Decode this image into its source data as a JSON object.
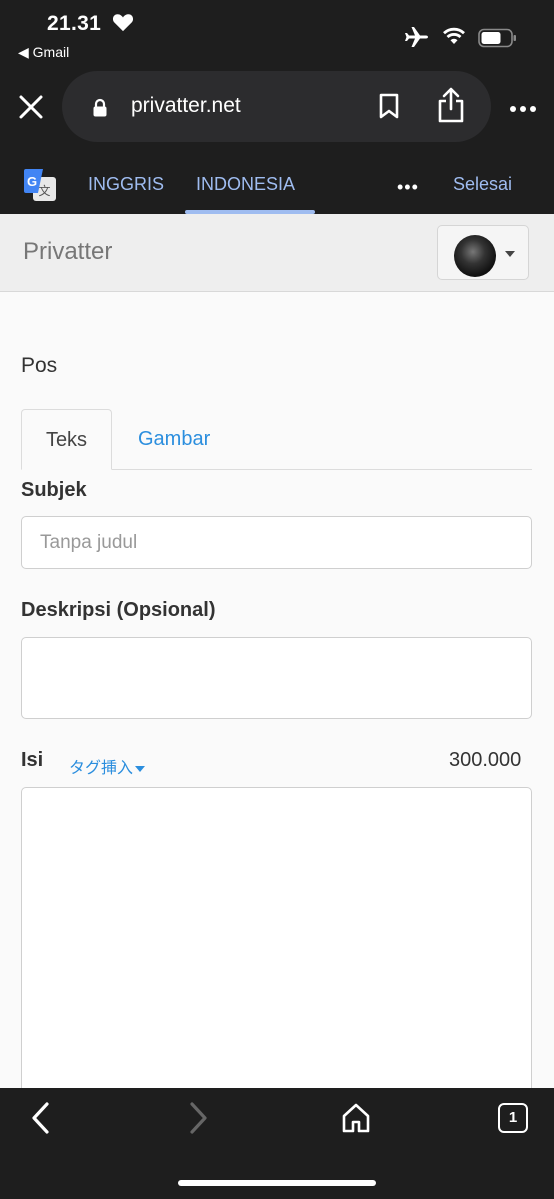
{
  "status_bar": {
    "time": "21.31",
    "back_app": "◀ Gmail",
    "icons": [
      "heart-icon",
      "airplane-icon",
      "wifi-icon",
      "battery-icon"
    ]
  },
  "browser": {
    "url": "privatter.net",
    "icons": [
      "close-icon",
      "lock-icon",
      "bookmark-icon",
      "share-icon",
      "more-icon"
    ]
  },
  "translate_bar": {
    "source_lang": "INGGRIS",
    "target_lang": "INDONESIA",
    "more": "•••",
    "done": "Selesai",
    "accent": "#9fbcf0"
  },
  "site": {
    "brand": "Privatter"
  },
  "form": {
    "section_title": "Pos",
    "tabs": [
      {
        "label": "Teks",
        "active": true
      },
      {
        "label": "Gambar",
        "active": false
      }
    ],
    "subject": {
      "label": "Subjek",
      "placeholder": "Tanpa judul",
      "value": ""
    },
    "description": {
      "label": "Deskripsi (Opsional)",
      "value": ""
    },
    "body": {
      "label": "Isi",
      "tag_insert": "タグ挿入",
      "char_count": "300.000",
      "value": ""
    },
    "link_color": "#2b8ede"
  },
  "toolbar": {
    "tab_count": "1",
    "icons": [
      "back-arrow-icon",
      "forward-arrow-icon",
      "home-icon",
      "tabs-icon"
    ]
  }
}
